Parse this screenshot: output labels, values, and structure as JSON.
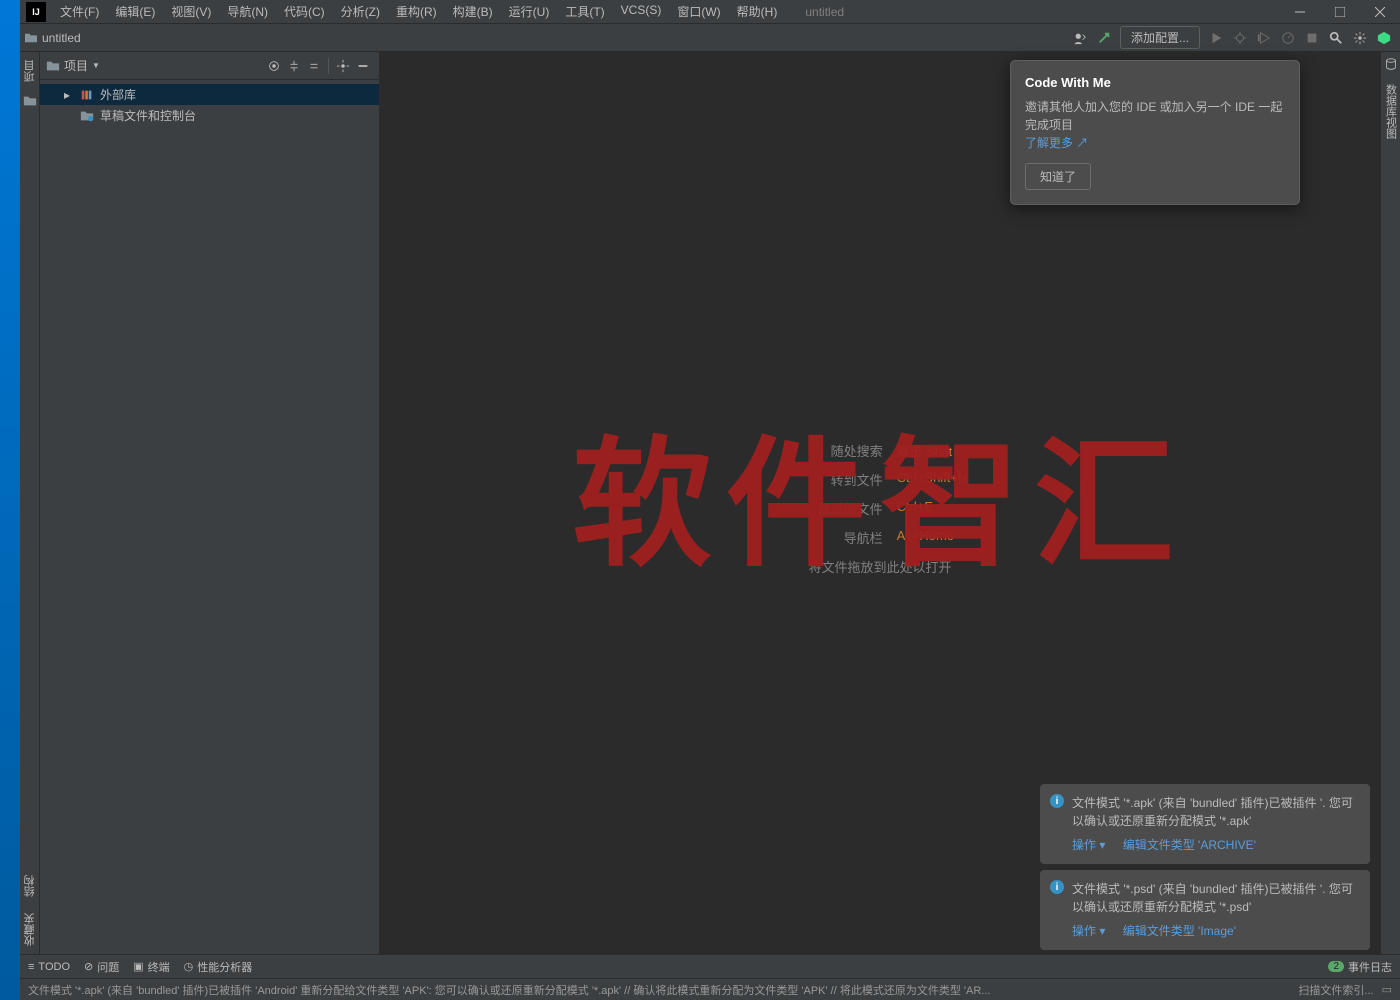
{
  "window": {
    "title": "untitled"
  },
  "menu": {
    "file": "文件(F)",
    "edit": "编辑(E)",
    "view": "视图(V)",
    "navigate": "导航(N)",
    "code": "代码(C)",
    "analyze": "分析(Z)",
    "refactor": "重构(R)",
    "build": "构建(B)",
    "run": "运行(U)",
    "tools": "工具(T)",
    "vcs": "VCS(S)",
    "window": "窗口(W)",
    "help": "帮助(H)"
  },
  "navbar": {
    "project": "untitled",
    "add_config": "添加配置..."
  },
  "gutter": {
    "project": "项目",
    "structure": "结构",
    "favorites": "收藏夹",
    "database": "数据库视图"
  },
  "sidebar": {
    "title": "项目",
    "items": [
      {
        "label": "外部库"
      },
      {
        "label": "草稿文件和控制台"
      }
    ]
  },
  "hints": {
    "search_label": "随处搜索",
    "search_key": "双击 Shift",
    "goto_label": "转到文件",
    "goto_key": "Ctrl+Shift+N",
    "recent_label": "最近的文件",
    "recent_key": "Ctrl+E",
    "navbar_label": "导航栏",
    "navbar_key": "Alt+Home",
    "drop": "将文件拖放到此处以打开"
  },
  "watermark": "软件智汇",
  "popup": {
    "title": "Code With Me",
    "body": "邀请其他人加入您的 IDE 或加入另一个 IDE 一起完成项目",
    "learn_more": "了解更多",
    "ok": "知道了"
  },
  "notifications": [
    {
      "text": "文件模式 '*.apk' (来自 'bundled' 插件)已被插件 '. 您可以确认或还原重新分配模式 '*.apk'",
      "action1": "操作",
      "action2": "编辑文件类型 'ARCHIVE'"
    },
    {
      "text": "文件模式 '*.psd' (来自 'bundled' 插件)已被插件 '. 您可以确认或还原重新分配模式 '*.psd'",
      "action1": "操作",
      "action2": "编辑文件类型 'Image'"
    }
  ],
  "bottombar": {
    "todo": "TODO",
    "problems": "问题",
    "terminal": "终端",
    "profiler": "性能分析器",
    "event_log": "事件日志",
    "event_count": "2"
  },
  "statusbar": {
    "left": "文件模式 '*.apk' (来自 'bundled' 插件)已被插件 'Android' 重新分配给文件类型 'APK': 您可以确认或还原重新分配模式 '*.apk' // 确认将此模式重新分配为文件类型 'APK' // 将此模式还原为文件类型 'AR...",
    "right": "扫描文件索引..."
  }
}
